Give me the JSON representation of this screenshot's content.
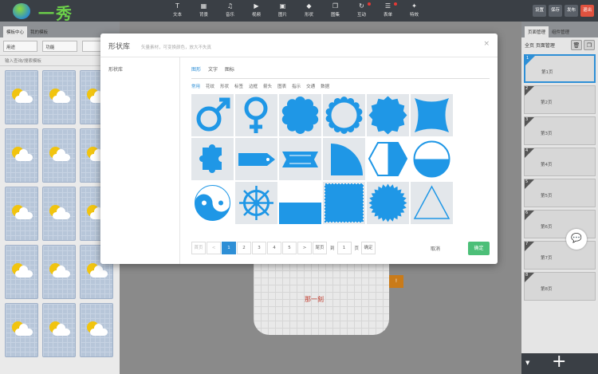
{
  "topbar": {
    "logo_text": "一秀",
    "tools": [
      {
        "label": "文本",
        "icon": "text-icon",
        "glyph": "T",
        "dot": false
      },
      {
        "label": "背景",
        "icon": "background-icon",
        "glyph": "▦",
        "dot": false
      },
      {
        "label": "音乐",
        "icon": "music-icon",
        "glyph": "♫",
        "dot": false
      },
      {
        "label": "视频",
        "icon": "video-icon",
        "glyph": "▶",
        "dot": false
      },
      {
        "label": "图片",
        "icon": "image-icon",
        "glyph": "▣",
        "dot": false
      },
      {
        "label": "形状",
        "icon": "shape-icon",
        "glyph": "◆",
        "dot": false
      },
      {
        "label": "图集",
        "icon": "gallery-icon",
        "glyph": "❐",
        "dot": false
      },
      {
        "label": "互动",
        "icon": "interact-icon",
        "glyph": "↻",
        "dot": true
      },
      {
        "label": "表单",
        "icon": "form-icon",
        "glyph": "☰",
        "dot": true
      },
      {
        "label": "特效",
        "icon": "effect-icon",
        "glyph": "✦",
        "dot": false
      }
    ],
    "buttons": {
      "settings": "设置",
      "save": "保存",
      "publish": "发布",
      "exit": "退出"
    }
  },
  "left_panel": {
    "tabs": [
      "模板中心",
      "我的模板"
    ],
    "select_1": "用途",
    "select_2": "功能",
    "search_placeholder": "输入查询/搜索模板",
    "thumb_count": 15
  },
  "canvas": {
    "phone_text": "那一刻",
    "badge": "!"
  },
  "right_panel": {
    "tabs": [
      "页面管理",
      "组件管理"
    ],
    "label": "全页 页面管理",
    "pages": [
      {
        "n": "1",
        "label": "第1页"
      },
      {
        "n": "2",
        "label": "第2页"
      },
      {
        "n": "3",
        "label": "第3页"
      },
      {
        "n": "4",
        "label": "第4页"
      },
      {
        "n": "5",
        "label": "第5页"
      },
      {
        "n": "6",
        "label": "第6页"
      },
      {
        "n": "7",
        "label": "第7页"
      },
      {
        "n": "8",
        "label": "第8页"
      }
    ],
    "add": "+"
  },
  "modal": {
    "title": "形状库",
    "hint": "矢量素材，可变换颜色，放大不失真",
    "close": "×",
    "left_item": "形状库",
    "tabs": [
      {
        "label": "图形",
        "on": true
      },
      {
        "label": "文字",
        "on": false
      },
      {
        "label": "图标",
        "on": false
      }
    ],
    "categories": [
      {
        "label": "常用",
        "on": true
      },
      {
        "label": "花纹",
        "on": false
      },
      {
        "label": "形状",
        "on": false
      },
      {
        "label": "标签",
        "on": false
      },
      {
        "label": "边框",
        "on": false
      },
      {
        "label": "箭头",
        "on": false
      },
      {
        "label": "图表",
        "on": false
      },
      {
        "label": "指示",
        "on": false
      },
      {
        "label": "交通",
        "on": false
      },
      {
        "label": "数据",
        "on": false
      }
    ],
    "shapes": [
      "male-symbol",
      "female-symbol",
      "scalloped-circle",
      "scalloped-ring",
      "badge-seal",
      "wavy-square",
      "puzzle-piece",
      "tag-shape",
      "ribbon-banner",
      "quarter-circle",
      "hexagon-half",
      "half-circle",
      "yin-yang",
      "ship-wheel",
      "rectangle-banner",
      "stamp-square",
      "starburst-circle",
      "outline-triangle"
    ],
    "pager": {
      "first": "首页",
      "prev": "<",
      "pages": [
        "1",
        "2",
        "3",
        "4",
        "5"
      ],
      "current": "1",
      "next": ">",
      "last": "尾页",
      "goto": "到",
      "goto_value": "1",
      "page_unit": "页",
      "confirm_go": "确定"
    },
    "cancel": "取消",
    "ok": "确定"
  },
  "colors": {
    "accent": "#1f97e6",
    "ok": "#4cbf78",
    "exit": "#e0523f",
    "topbar": "#3a3f45"
  }
}
